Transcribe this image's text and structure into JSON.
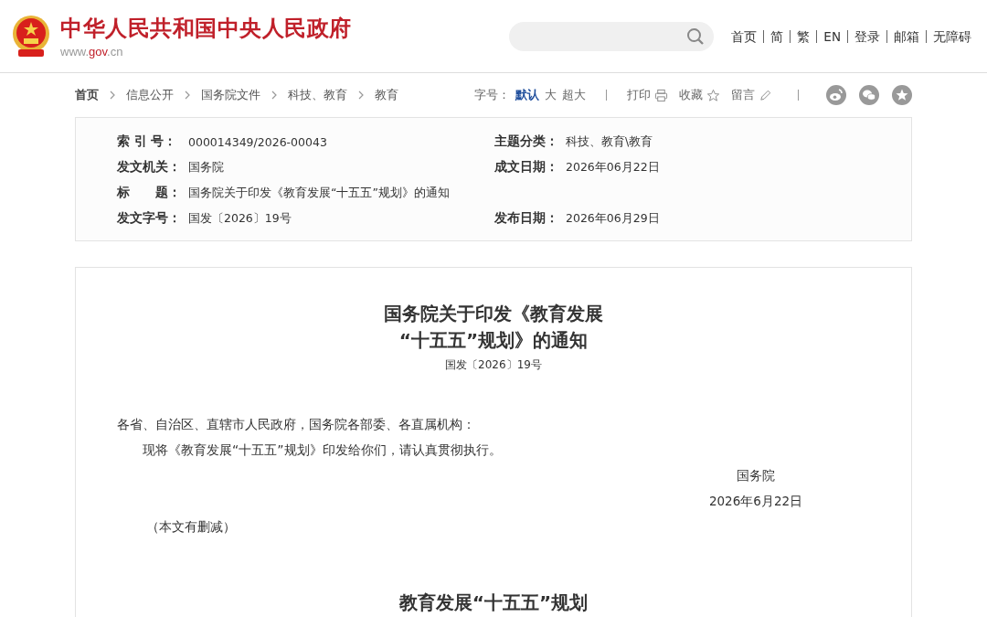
{
  "header": {
    "title": "中华人民共和国中央人民政府",
    "url_parts": [
      "www.",
      "gov",
      ".cn"
    ],
    "nav": [
      "首页",
      "简",
      "繁",
      "EN",
      "登录",
      "邮箱",
      "无障碍"
    ]
  },
  "breadcrumb": [
    "首页",
    "信息公开",
    "国务院文件",
    "科技、教育",
    "教育"
  ],
  "font_size": {
    "label": "字号：",
    "options": [
      {
        "label": "默认",
        "selected": true
      },
      {
        "label": "大",
        "selected": false
      },
      {
        "label": "超大",
        "selected": false
      }
    ]
  },
  "actions": [
    {
      "label": "打印",
      "kind": "print"
    },
    {
      "label": "收藏",
      "kind": "star"
    },
    {
      "label": "留言",
      "kind": "pen"
    }
  ],
  "share": [
    {
      "kind": "weibo"
    },
    {
      "kind": "chat"
    },
    {
      "kind": "star"
    }
  ],
  "meta": [
    {
      "left": {
        "label": "索 引 号：",
        "value": "000014349/2026-00043"
      },
      "right": {
        "label": "主题分类：",
        "value": "科技、教育\\教育"
      }
    },
    {
      "left": {
        "label": "发文机关：",
        "value": "国务院"
      },
      "right": {
        "label": "成文日期：",
        "value": "2026年06月22日"
      }
    },
    {
      "left": {
        "label": "标　　题：",
        "value": "国务院关于印发《教育发展“十五五”规划》的通知"
      }
    },
    {
      "left": {
        "label": "发文字号：",
        "value": "国发〔2026〕19号"
      },
      "right": {
        "label": "发布日期：",
        "value": "2026年06月29日"
      }
    }
  ],
  "document": {
    "title_lines": [
      "国务院关于印发《教育发展",
      "“十五五”规划》的通知"
    ],
    "number": "国发〔2026〕19号",
    "salutation": "各省、自治区、直辖市人民政府，国务院各部委、各直属机构：",
    "body": "现将《教育发展“十五五”规划》印发给你们，请认真贯彻执行。",
    "signature": "国务院",
    "date": "2026年6月22日",
    "note": "（本文有删减）",
    "section_heading": "教育发展“十五五”规划"
  }
}
